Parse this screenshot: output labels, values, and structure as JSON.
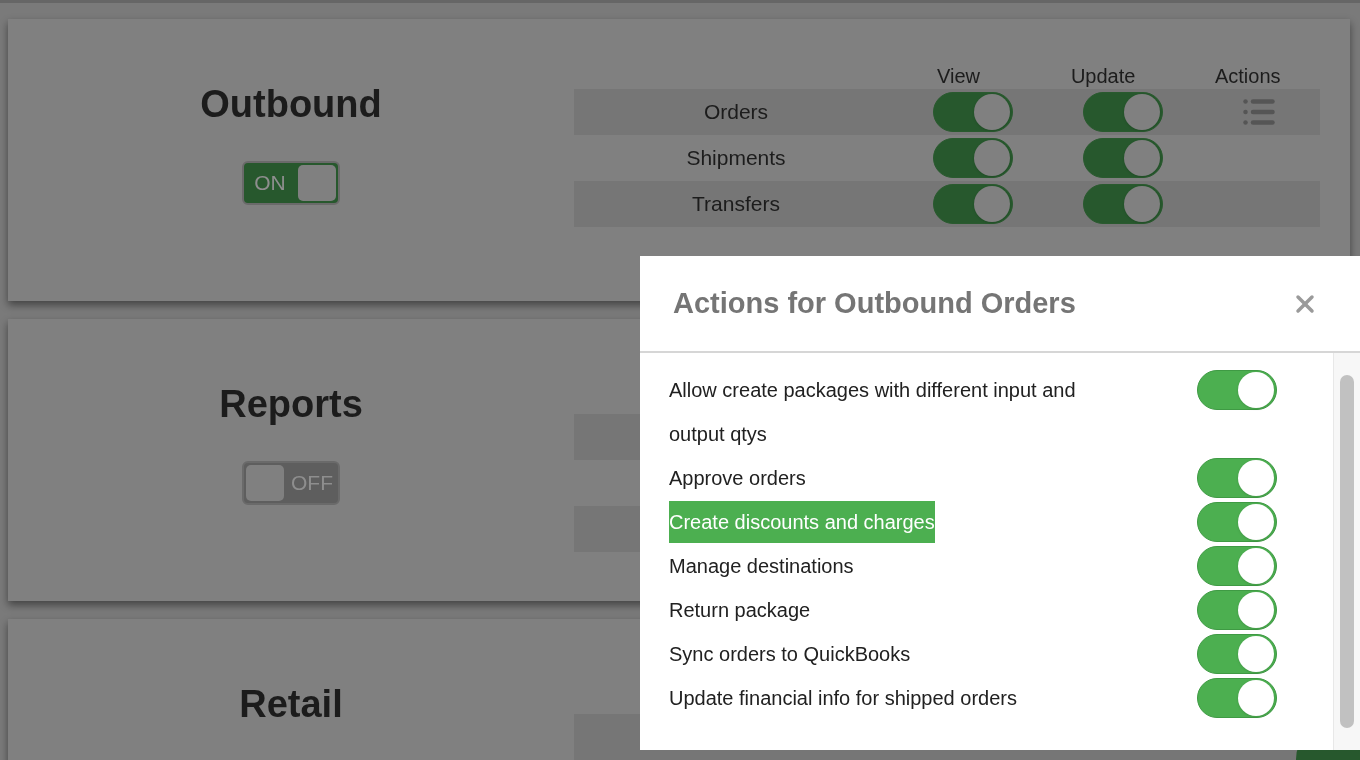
{
  "sections": [
    {
      "title": "Outbound",
      "toggle": {
        "label": "ON",
        "on": true
      },
      "columns": [
        "View",
        "Update",
        "Actions"
      ],
      "rows": [
        {
          "name": "Orders",
          "shaded": true,
          "view": true,
          "update": true,
          "has_actions": true
        },
        {
          "name": "Shipments",
          "shaded": false,
          "view": true,
          "update": true,
          "has_actions": false
        },
        {
          "name": "Transfers",
          "shaded": true,
          "view": true,
          "update": true,
          "has_actions": false
        }
      ]
    },
    {
      "title": "Reports",
      "toggle": {
        "label": "OFF",
        "on": false
      },
      "rows": [
        {
          "kind": "bar"
        },
        {
          "kind": "gap"
        },
        {
          "kind": "bar"
        }
      ]
    },
    {
      "title": "Retail",
      "rows": [
        {
          "kind": "bar"
        }
      ]
    }
  ],
  "dialog": {
    "title": "Actions for Outbound Orders",
    "items": [
      {
        "label": "Allow create packages with different input and output qtys",
        "on": true,
        "highlighted": false
      },
      {
        "label": "Approve orders",
        "on": true,
        "highlighted": false
      },
      {
        "label": "Create discounts and charges",
        "on": true,
        "highlighted": true
      },
      {
        "label": "Manage destinations",
        "on": true,
        "highlighted": false
      },
      {
        "label": "Return package",
        "on": true,
        "highlighted": false
      },
      {
        "label": "Sync orders to QuickBooks",
        "on": true,
        "highlighted": false
      },
      {
        "label": "Update financial info for shipped orders",
        "on": true,
        "highlighted": false
      }
    ]
  }
}
